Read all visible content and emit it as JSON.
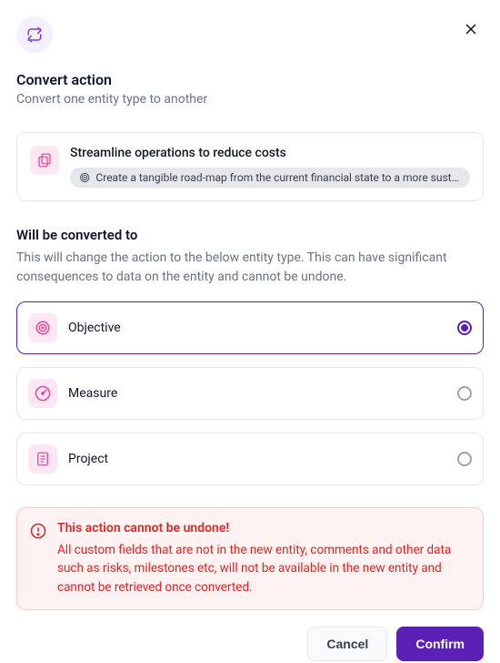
{
  "header": {
    "title": "Convert action",
    "subtitle": "Convert one entity type to another"
  },
  "entity": {
    "title": "Streamline operations to reduce costs",
    "chip": "Create a tangible road-map from the current financial state to a more sustainable one"
  },
  "section": {
    "title": "Will be converted to",
    "description": "This will change the action to the below entity type. This can have significant consequences to data on the entity and cannot be undone."
  },
  "options": [
    {
      "label": "Objective",
      "selected": true
    },
    {
      "label": "Measure",
      "selected": false
    },
    {
      "label": "Project",
      "selected": false
    }
  ],
  "alert": {
    "title": "This action cannot be undone!",
    "text": "All custom fields that are not in the new entity, comments and other data such as risks, milestones etc, will not be available in the new entity and cannot be retrieved once converted."
  },
  "footer": {
    "cancel": "Cancel",
    "confirm": "Confirm"
  }
}
